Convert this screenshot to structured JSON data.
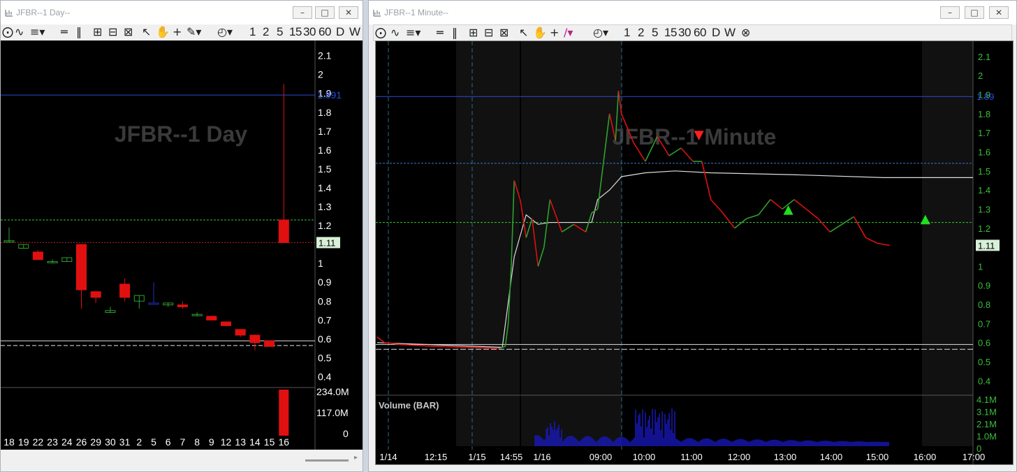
{
  "left_window": {
    "title": "JFBR--1 Day--",
    "watermark": "JFBR--1 Day",
    "toolbar_timeframes": [
      "1",
      "2",
      "5",
      "15",
      "30",
      "60",
      "D",
      "W"
    ],
    "price_axis": [
      "2.1",
      "2",
      "1.9",
      "1.8",
      "1.7",
      "1.6",
      "1.5",
      "1.4",
      "1.3",
      "1.2",
      "1.1",
      "1",
      "0.9",
      "0.8",
      "0.7",
      "0.6",
      "0.5",
      "0.4"
    ],
    "blue_line_label": "1.891",
    "last_price_label": "1.11",
    "volume_axis": [
      "234.0M",
      "117.0M",
      "0"
    ],
    "date_axis": [
      "18",
      "19",
      "22",
      "23",
      "24",
      "26",
      "29",
      "30",
      "31",
      "2",
      "5",
      "6",
      "7",
      "8",
      "9",
      "12",
      "13",
      "14",
      "15",
      "16"
    ]
  },
  "right_window": {
    "title": "JFBR--1 Minute--",
    "watermark": "JFBR--1 Minute",
    "toolbar_timeframes": [
      "1",
      "2",
      "5",
      "15",
      "30",
      "60",
      "D",
      "W"
    ],
    "price_axis": [
      "2.1",
      "2",
      "1.9",
      "1.8",
      "1.7",
      "1.6",
      "1.5",
      "1.4",
      "1.3",
      "1.2",
      "1.1",
      "1",
      "0.9",
      "0.8",
      "0.7",
      "0.6",
      "0.5",
      "0.4"
    ],
    "blue_line_label": "1.89",
    "last_price_label": "1.11",
    "volume_title": "Volume (BAR)",
    "volume_axis": [
      "4.1M",
      "3.1M",
      "2.1M",
      "1.0M",
      "0"
    ],
    "time_axis": [
      "1/14",
      "12:15",
      "1/15",
      "14:55",
      "1/16",
      "09:00",
      "10:00",
      "11:00",
      "12:00",
      "13:00",
      "14:00",
      "15:00",
      "16:00",
      "17:00"
    ]
  },
  "colors": {
    "background": "#000000",
    "price_axis_text": "#3dbb3d",
    "blue_line": "#2a4bd7",
    "green_dashed": "#33cc33",
    "up_candle": "#2ea02e",
    "down_candle": "#e01010",
    "volume": "#1a1acc"
  },
  "chart_data": [
    {
      "type": "candlestick",
      "title": "JFBR--1 Day",
      "categories": [
        "18",
        "19",
        "22",
        "23",
        "24",
        "26",
        "29",
        "30",
        "31",
        "2",
        "5",
        "6",
        "7",
        "8",
        "9",
        "12",
        "13",
        "14",
        "15",
        "16"
      ],
      "ohlc": [
        [
          1.12,
          1.19,
          1.11,
          1.12
        ],
        [
          1.08,
          1.1,
          1.08,
          1.1
        ],
        [
          1.06,
          1.07,
          1.02,
          1.02
        ],
        [
          1.01,
          1.02,
          1.0,
          1.01
        ],
        [
          1.01,
          1.03,
          1.01,
          1.03
        ],
        [
          1.1,
          1.1,
          0.76,
          0.86
        ],
        [
          0.85,
          0.85,
          0.79,
          0.82
        ],
        [
          0.74,
          0.77,
          0.74,
          0.75
        ],
        [
          0.89,
          0.92,
          0.8,
          0.82
        ],
        [
          0.8,
          0.83,
          0.76,
          0.83
        ],
        [
          0.79,
          0.9,
          0.79,
          0.79
        ],
        [
          0.78,
          0.79,
          0.77,
          0.79
        ],
        [
          0.78,
          0.8,
          0.76,
          0.77
        ],
        [
          0.73,
          0.74,
          0.72,
          0.73
        ],
        [
          0.72,
          0.72,
          0.7,
          0.7
        ],
        [
          0.69,
          0.69,
          0.67,
          0.67
        ],
        [
          0.65,
          0.65,
          0.61,
          0.62
        ],
        [
          0.62,
          0.62,
          0.54,
          0.58
        ],
        [
          0.59,
          0.59,
          0.56,
          0.56
        ],
        [
          1.23,
          1.95,
          1.11,
          1.11
        ]
      ],
      "volume_last": 234.0,
      "ylim": [
        0.35,
        2.18
      ],
      "lines": {
        "blue": 1.891,
        "green_dashed": 1.23,
        "red_dotted": 1.11,
        "white_solid": 0.59,
        "white_dashed": 0.565
      }
    },
    {
      "type": "line",
      "title": "JFBR--1 Minute",
      "ylim": [
        0.35,
        2.18
      ],
      "price_path": [
        [
          0,
          0.63
        ],
        [
          0.012,
          0.6
        ],
        [
          0.04,
          0.59
        ],
        [
          0.1,
          0.58
        ],
        [
          0.16,
          0.575
        ],
        [
          0.205,
          0.57
        ],
        [
          0.215,
          0.58
        ],
        [
          0.22,
          0.7
        ],
        [
          0.225,
          1.0
        ],
        [
          0.23,
          1.45
        ],
        [
          0.24,
          1.35
        ],
        [
          0.25,
          1.15
        ],
        [
          0.26,
          1.25
        ],
        [
          0.27,
          1.0
        ],
        [
          0.28,
          1.1
        ],
        [
          0.29,
          1.35
        ],
        [
          0.31,
          1.18
        ],
        [
          0.33,
          1.22
        ],
        [
          0.35,
          1.18
        ],
        [
          0.36,
          1.28
        ],
        [
          0.37,
          1.3
        ],
        [
          0.38,
          1.55
        ],
        [
          0.39,
          1.8
        ],
        [
          0.4,
          1.66
        ],
        [
          0.405,
          1.92
        ],
        [
          0.41,
          1.8
        ],
        [
          0.43,
          1.65
        ],
        [
          0.45,
          1.55
        ],
        [
          0.47,
          1.68
        ],
        [
          0.49,
          1.58
        ],
        [
          0.51,
          1.62
        ],
        [
          0.53,
          1.55
        ],
        [
          0.545,
          1.55
        ],
        [
          0.56,
          1.35
        ],
        [
          0.58,
          1.28
        ],
        [
          0.6,
          1.2
        ],
        [
          0.62,
          1.25
        ],
        [
          0.64,
          1.27
        ],
        [
          0.66,
          1.35
        ],
        [
          0.68,
          1.3
        ],
        [
          0.7,
          1.35
        ],
        [
          0.72,
          1.3
        ],
        [
          0.74,
          1.25
        ],
        [
          0.76,
          1.18
        ],
        [
          0.78,
          1.22
        ],
        [
          0.8,
          1.26
        ],
        [
          0.82,
          1.15
        ],
        [
          0.84,
          1.12
        ],
        [
          0.86,
          1.11
        ]
      ],
      "vwap_path": [
        [
          0,
          0.6
        ],
        [
          0.21,
          0.575
        ],
        [
          0.23,
          1.05
        ],
        [
          0.25,
          1.27
        ],
        [
          0.27,
          1.22
        ],
        [
          0.29,
          1.23
        ],
        [
          0.33,
          1.23
        ],
        [
          0.36,
          1.23
        ],
        [
          0.37,
          1.35
        ],
        [
          0.39,
          1.4
        ],
        [
          0.41,
          1.47
        ],
        [
          0.45,
          1.49
        ],
        [
          0.5,
          1.5
        ],
        [
          0.56,
          1.49
        ],
        [
          0.7,
          1.48
        ],
        [
          0.85,
          1.465
        ],
        [
          1.0,
          1.465
        ]
      ],
      "volume_max": 4.1,
      "lines": {
        "blue": 1.89,
        "blue_dashed": 1.54,
        "green_dashed": 1.23,
        "white_solid": 0.59,
        "white_dashed": 0.565
      }
    }
  ]
}
